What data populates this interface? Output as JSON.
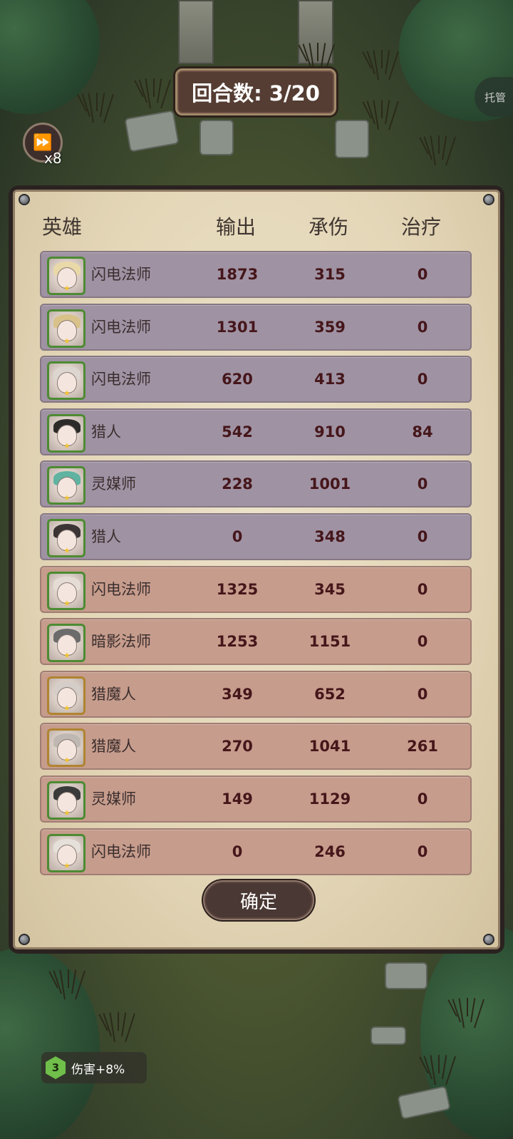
{
  "hud": {
    "round_text": "回合数: 3/20",
    "speed_multiplier": "x8",
    "auto_label": "托管",
    "buff": {
      "level": "3",
      "text": "伤害+8%"
    }
  },
  "table": {
    "headers": {
      "hero": "英雄",
      "output": "输出",
      "damage_taken": "承伤",
      "healing": "治疗"
    },
    "rows": [
      {
        "team": "ally",
        "name": "闪电法师",
        "output": "1873",
        "damage_taken": "315",
        "healing": "0"
      },
      {
        "team": "ally",
        "name": "闪电法师",
        "output": "1301",
        "damage_taken": "359",
        "healing": "0"
      },
      {
        "team": "ally",
        "name": "闪电法师",
        "output": "620",
        "damage_taken": "413",
        "healing": "0"
      },
      {
        "team": "ally",
        "name": "猎人",
        "output": "542",
        "damage_taken": "910",
        "healing": "84"
      },
      {
        "team": "ally",
        "name": "灵媒师",
        "output": "228",
        "damage_taken": "1001",
        "healing": "0"
      },
      {
        "team": "ally",
        "name": "猎人",
        "output": "0",
        "damage_taken": "348",
        "healing": "0"
      },
      {
        "team": "enemy",
        "name": "闪电法师",
        "output": "1325",
        "damage_taken": "345",
        "healing": "0"
      },
      {
        "team": "enemy",
        "name": "暗影法师",
        "output": "1253",
        "damage_taken": "1151",
        "healing": "0"
      },
      {
        "team": "enemy",
        "name": "猎魔人",
        "output": "349",
        "damage_taken": "652",
        "healing": "0"
      },
      {
        "team": "enemy",
        "name": "猎魔人",
        "output": "270",
        "damage_taken": "1041",
        "healing": "261"
      },
      {
        "team": "enemy",
        "name": "灵媒师",
        "output": "149",
        "damage_taken": "1129",
        "healing": "0"
      },
      {
        "team": "enemy",
        "name": "闪电法师",
        "output": "0",
        "damage_taken": "246",
        "healing": "0"
      }
    ]
  },
  "confirm_label": "确定"
}
